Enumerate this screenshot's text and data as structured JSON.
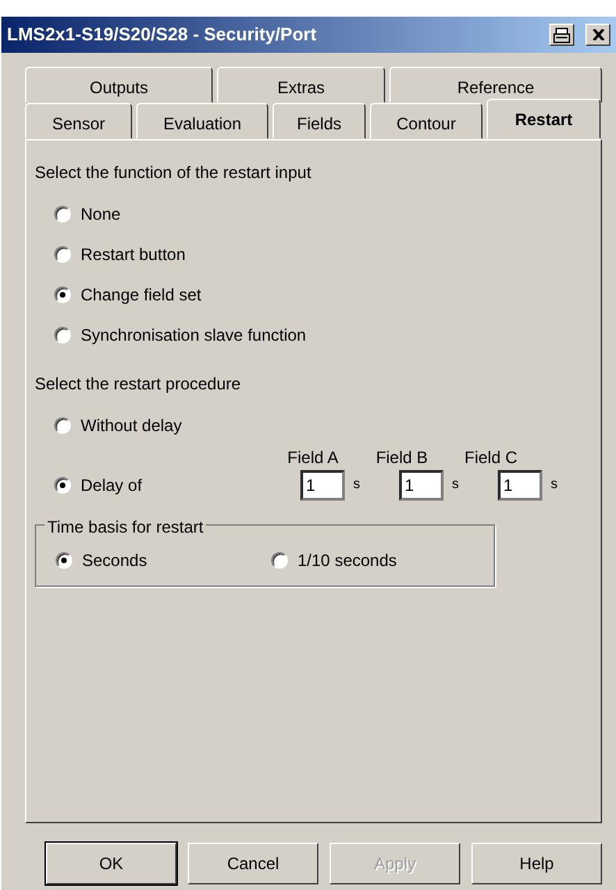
{
  "window": {
    "title": "LMS2x1-S19/S20/S28 - Security/Port"
  },
  "tab_rows": [
    {
      "tabs": [
        {
          "label": "Outputs",
          "selected": false
        },
        {
          "label": "Extras",
          "selected": false
        },
        {
          "label": "Reference",
          "selected": false
        }
      ]
    },
    {
      "tabs": [
        {
          "label": "Sensor",
          "selected": false
        },
        {
          "label": "Evaluation",
          "selected": false
        },
        {
          "label": "Fields",
          "selected": false
        },
        {
          "label": "Contour",
          "selected": false
        },
        {
          "label": "Restart",
          "selected": true
        }
      ]
    }
  ],
  "restart_input": {
    "label": "Select the function of the restart input",
    "options": [
      {
        "label": "None",
        "selected": false
      },
      {
        "label": "Restart button",
        "selected": false
      },
      {
        "label": "Change field set",
        "selected": true
      },
      {
        "label": "Synchronisation slave function",
        "selected": false
      }
    ]
  },
  "restart_procedure": {
    "label": "Select the restart procedure",
    "options": [
      {
        "label": "Without delay",
        "selected": false
      },
      {
        "label": "Delay of",
        "selected": true
      }
    ],
    "fields": [
      {
        "label": "Field A",
        "value": "1",
        "unit": "s"
      },
      {
        "label": "Field B",
        "value": "1",
        "unit": "s"
      },
      {
        "label": "Field C",
        "value": "1",
        "unit": "s"
      }
    ]
  },
  "time_basis": {
    "label": "Time basis for restart",
    "options": [
      {
        "label": "Seconds",
        "selected": true
      },
      {
        "label": "1/10 seconds",
        "selected": false
      }
    ]
  },
  "buttons": [
    {
      "label": "OK",
      "default": true,
      "disabled": false
    },
    {
      "label": "Cancel",
      "default": false,
      "disabled": false
    },
    {
      "label": "Apply",
      "default": false,
      "disabled": true
    },
    {
      "label": "Help",
      "default": false,
      "disabled": false
    }
  ]
}
